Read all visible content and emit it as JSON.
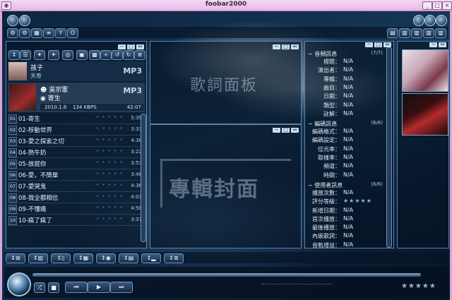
{
  "window": {
    "title": "foobar2000"
  },
  "toolbar": {
    "left_icons": [
      "gear-icon",
      "gears-icon",
      "grid-icon",
      "dsp-icon",
      "yi-icon",
      "os-icon"
    ]
  },
  "now_playing": {
    "title": "孩子",
    "artist": "天寿",
    "format_badge": "MP3",
    "album_artist": "吳宗憲",
    "album": "寄生",
    "date": "2010.1.8",
    "bitrate": "134 KBPS",
    "elapsed": "42:07"
  },
  "playlist": {
    "items": [
      {
        "num": "01",
        "title": "01-寄生",
        "duration": "5:39"
      },
      {
        "num": "02",
        "title": "02-移動世界",
        "duration": "3:33"
      },
      {
        "num": "03",
        "title": "03-愛之探索之切",
        "duration": "4:38"
      },
      {
        "num": "04",
        "title": "04-熱牛奶",
        "duration": "3:22"
      },
      {
        "num": "05",
        "title": "05-放屁你",
        "duration": "3:53"
      },
      {
        "num": "06",
        "title": "06-愛，不簡單",
        "duration": "3:48"
      },
      {
        "num": "07",
        "title": "07-愛哭鬼",
        "duration": "4:36"
      },
      {
        "num": "08",
        "title": "08-我全都相信",
        "duration": "4:03"
      },
      {
        "num": "09",
        "title": "09-不懂痛",
        "duration": "4:58"
      },
      {
        "num": "10",
        "title": "10-瘋了瘋了",
        "duration": "3:37"
      }
    ]
  },
  "lyrics_panel": {
    "watermark": "歌詞面板"
  },
  "cover_panel": {
    "watermark": "專輯封面"
  },
  "info": {
    "audio_section": {
      "title": "音頻訊息",
      "count": "(7/7)",
      "fields": [
        {
          "k": "標題：",
          "v": "N/A"
        },
        {
          "k": "演出者：",
          "v": "N/A"
        },
        {
          "k": "專輯：",
          "v": "N/A"
        },
        {
          "k": "曲目：",
          "v": "N/A"
        },
        {
          "k": "日期：",
          "v": "N/A"
        },
        {
          "k": "類型：",
          "v": "N/A"
        },
        {
          "k": "註解：",
          "v": "N/A"
        }
      ]
    },
    "codec_section": {
      "title": "編碼訊息",
      "count": "(6/6)",
      "fields": [
        {
          "k": "編碼格式：",
          "v": "N/A"
        },
        {
          "k": "編碼設定：",
          "v": "N/A"
        },
        {
          "k": "位元率：",
          "v": "N/A"
        },
        {
          "k": "取樣率：",
          "v": "N/A"
        },
        {
          "k": "頻道：",
          "v": "N/A"
        },
        {
          "k": "時間：",
          "v": "N/A"
        }
      ]
    },
    "usage_section": {
      "title": "使用者訊息",
      "count": "(6/6)",
      "fields": [
        {
          "k": "播放次數：",
          "v": "N/A"
        },
        {
          "k": "評分等級：",
          "v": ""
        },
        {
          "k": "新增日期：",
          "v": "N/A"
        },
        {
          "k": "首次播放：",
          "v": "N/A"
        },
        {
          "k": "最後播放：",
          "v": "N/A"
        },
        {
          "k": "內嵌歌詞：",
          "v": "N/A"
        },
        {
          "k": "音軌增益：",
          "v": "N/A"
        }
      ]
    }
  },
  "bottom_bar": {
    "stars": "★★★★★",
    "rating_stars": "★★★★★"
  },
  "colors": {
    "title_bar": "#e6b8e6",
    "accent": "#5e82a6",
    "background": "#0b1f35"
  }
}
